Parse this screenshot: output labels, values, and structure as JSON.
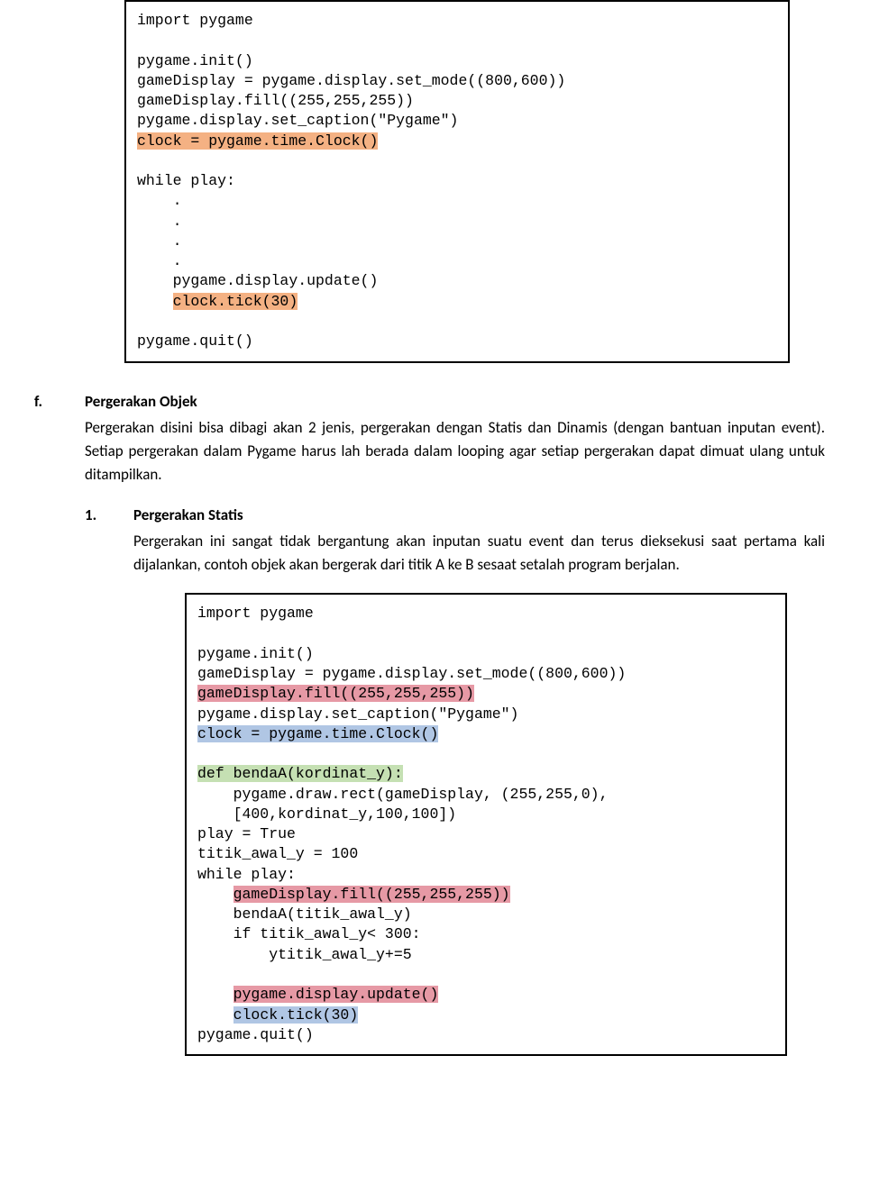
{
  "code1": {
    "l1": "import pygame",
    "l2": "",
    "l3": "pygame.init()",
    "l4": "gameDisplay = pygame.display.set_mode((800,600))",
    "l5": "gameDisplay.fill((255,255,255))",
    "l6": "pygame.display.set_caption(\"Pygame\")",
    "l7": "clock = pygame.time.Clock()",
    "l8": "",
    "l9": "while play:",
    "l10": "    .",
    "l11": "    .",
    "l12": "    .",
    "l13": "    .",
    "l14": "    pygame.display.update()",
    "l15_indent": "    ",
    "l15": "clock.tick(30)",
    "l16": "",
    "l17": "pygame.quit()"
  },
  "section_f": {
    "label": "f.",
    "title": "Pergerakan Objek",
    "para": "Pergerakan disini bisa dibagi akan 2 jenis, pergerakan dengan Statis dan Dinamis (dengan bantuan inputan event). Setiap pergerakan dalam Pygame harus lah berada dalam looping agar setiap pergerakan dapat dimuat ulang untuk ditampilkan."
  },
  "sub1": {
    "label": "1.",
    "title": "Pergerakan Statis",
    "para": "Pergerakan ini sangat tidak bergantung akan inputan suatu event dan terus dieksekusi saat pertama kali dijalankan, contoh objek akan bergerak dari titik A ke B sesaat setalah program berjalan."
  },
  "code2": {
    "l1": "import pygame",
    "l2": "",
    "l3": "pygame.init()",
    "l4": "gameDisplay = pygame.display.set_mode((800,600))",
    "l5": "gameDisplay.fill((255,255,255))",
    "l6": "pygame.display.set_caption(\"Pygame\")",
    "l7": "clock = pygame.time.Clock()",
    "l8": "",
    "l9": "def bendaA(kordinat_y):",
    "l10": "    pygame.draw.rect(gameDisplay, (255,255,0),",
    "l11": "    [400,kordinat_y,100,100])",
    "l12": "play = True",
    "l13": "titik_awal_y = 100",
    "l14": "while play:",
    "l15_indent": "    ",
    "l15": "gameDisplay.fill((255,255,255))",
    "l16": "    bendaA(titik_awal_y)",
    "l17": "    if titik_awal_y< 300:",
    "l18": "        ytitik_awal_y+=5",
    "l19": "",
    "l20_indent": "    ",
    "l20": "pygame.display.update()",
    "l21_indent": "    ",
    "l21": "clock.tick(30)",
    "l22": "pygame.quit()"
  }
}
